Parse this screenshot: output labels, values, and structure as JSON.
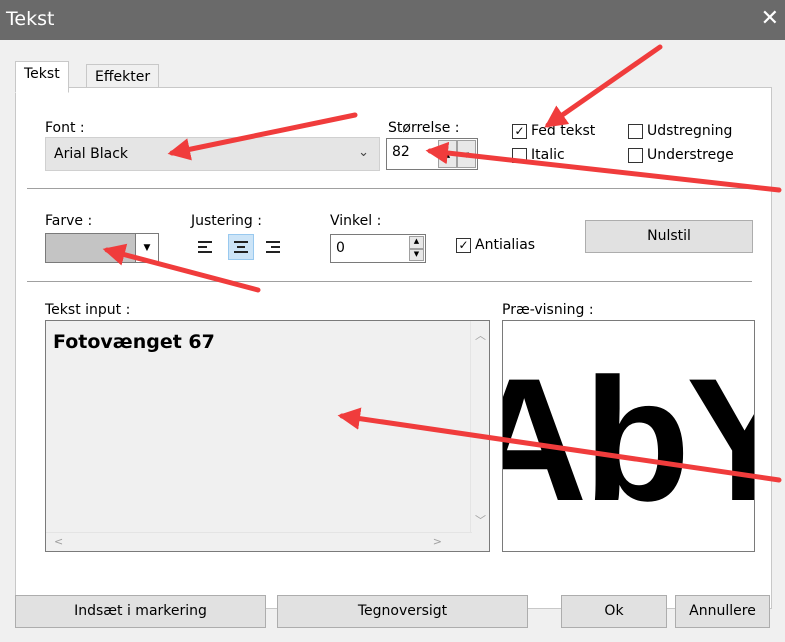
{
  "window": {
    "title": "Tekst",
    "close_glyph": "✕"
  },
  "tabs": [
    {
      "label": "Tekst",
      "active": true
    },
    {
      "label": "Effekter",
      "active": false
    }
  ],
  "font": {
    "label": "Font :",
    "value": "Arial Black",
    "chevron_icon": "chevron-down-icon"
  },
  "size": {
    "label": "Størrelse :",
    "value": "82"
  },
  "style_options": {
    "bold": {
      "label": "Fed tekst",
      "checked": true
    },
    "italic": {
      "label": "Italic",
      "checked": false
    },
    "strikethrough": {
      "label": "Udstregning",
      "checked": false
    },
    "underline": {
      "label": "Understrege",
      "checked": false
    }
  },
  "color": {
    "label": "Farve :",
    "swatch": "#c4c4c4"
  },
  "alignment": {
    "label": "Justering :",
    "selected": "center"
  },
  "angle": {
    "label": "Vinkel :",
    "value": "0"
  },
  "antialias": {
    "label": "Antialias",
    "checked": true
  },
  "reset_button": "Nulstil",
  "text_input": {
    "label": "Tekst input :",
    "value": "Fotovænget 67"
  },
  "preview": {
    "label": "Præ-visning :",
    "glyphs": "AbY"
  },
  "footer": {
    "insert_button": "Indsæt i markering",
    "charmap_button": "Tegnoversigt",
    "ok_button": "Ok",
    "cancel_button": "Annullere"
  },
  "annotation_color": "#f03c3c"
}
